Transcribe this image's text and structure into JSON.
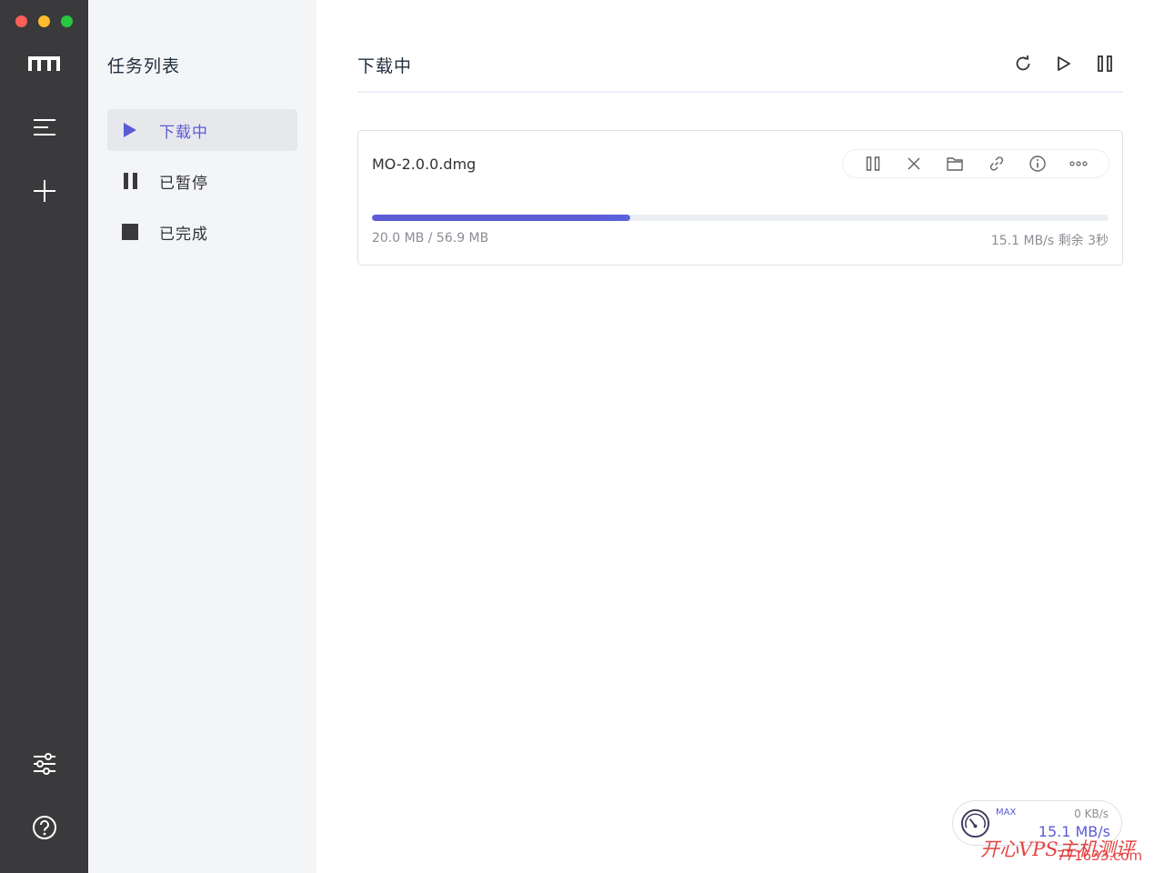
{
  "window": {
    "controls": [
      "close",
      "minimize",
      "zoom"
    ]
  },
  "rail": {
    "logo_icon": "motrix-logo-icon",
    "items": [
      {
        "name": "task-list-menu",
        "icon": "menu-lines-icon"
      },
      {
        "name": "new-task",
        "icon": "plus-icon"
      },
      {
        "name": "preferences",
        "icon": "sliders-icon"
      },
      {
        "name": "help",
        "icon": "question-circle-icon"
      }
    ]
  },
  "sidebar": {
    "title": "任务列表",
    "items": [
      {
        "label": "下载中",
        "icon": "play-icon",
        "active": true
      },
      {
        "label": "已暂停",
        "icon": "pause-icon",
        "active": false
      },
      {
        "label": "已完成",
        "icon": "stop-square-icon",
        "active": false
      }
    ]
  },
  "main": {
    "title": "下载中",
    "actions": [
      {
        "name": "refresh",
        "icon": "refresh-icon"
      },
      {
        "name": "resume-all",
        "icon": "play-outline-icon"
      },
      {
        "name": "pause-all",
        "icon": "pause-outline-icon"
      }
    ]
  },
  "task": {
    "name": "MO-2.0.0.dmg",
    "size_text": "20.0 MB / 56.9 MB",
    "downloaded_mb": 20.0,
    "total_mb": 56.9,
    "progress": 0.35,
    "speed_text": "15.1 MB/s 剩余 3秒",
    "actions": [
      {
        "name": "pause",
        "icon": "pause-outline-icon"
      },
      {
        "name": "delete",
        "icon": "close-icon"
      },
      {
        "name": "open-folder",
        "icon": "folder-icon"
      },
      {
        "name": "copy-link",
        "icon": "link-icon"
      },
      {
        "name": "info",
        "icon": "info-icon"
      },
      {
        "name": "more",
        "icon": "more-dots-icon"
      }
    ]
  },
  "speedometer": {
    "mode": "MAX",
    "upload": "0 KB/s",
    "download": "15.1 MB/s"
  },
  "watermark": {
    "text": "开心VPS主机测评",
    "site": "771633.com"
  },
  "colors": {
    "accent": "#5b5bd6",
    "rail": "#3a3a3c",
    "sidebar": "#f4f5f7",
    "watermark": "#e03030"
  }
}
